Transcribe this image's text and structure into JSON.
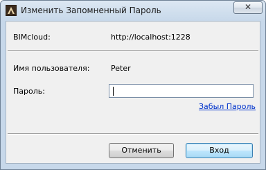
{
  "window": {
    "title": "Изменить Запомненный Пароль",
    "close_label": "✕"
  },
  "form": {
    "server_label": "BIMcloud:",
    "server_value": "http://localhost:1228",
    "user_label": "Имя пользователя:",
    "user_value": "Peter",
    "password_label": "Пароль:",
    "password_value": "",
    "forgot_link": "Забыл Пароль"
  },
  "buttons": {
    "cancel_label": "Отменить",
    "login_label": "Вход"
  },
  "colors": {
    "link": "#0033cc",
    "default_button_border": "#3c7fb1"
  },
  "icons": {
    "app": "archicad-app-icon",
    "close": "close-icon"
  }
}
